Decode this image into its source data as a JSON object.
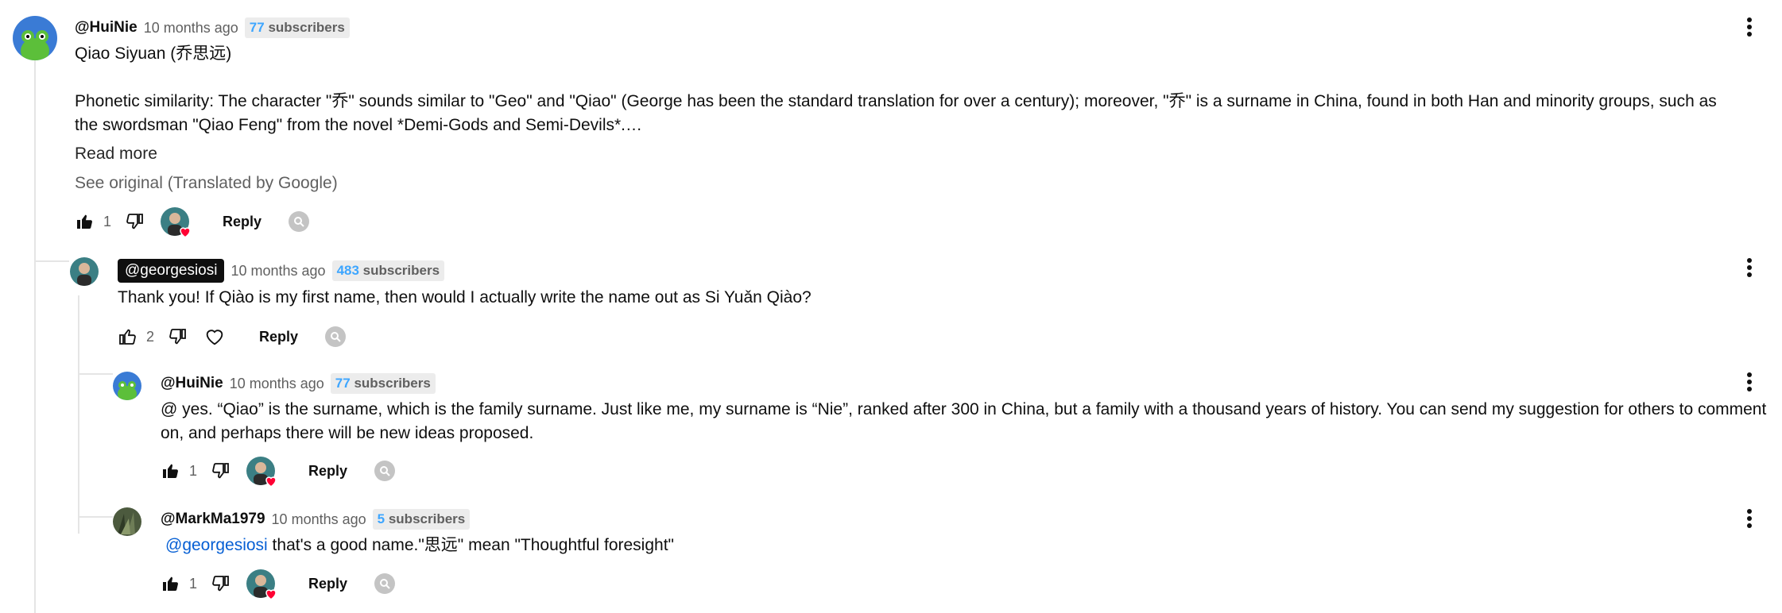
{
  "comment": {
    "handle": "@HuiNie",
    "time": "10 months ago",
    "subs_num": "77",
    "subs_label": "subscribers",
    "title_line": "Qiao Siyuan (乔思远)",
    "body": "Phonetic similarity: The character \"乔\" sounds similar to \"Geo\" and \"Qiao\" (George has been the standard translation for over a century); moreover, \"乔\" is a surname in China, found in both Han and minority groups, such as the swordsman \"Qiao Feng\" from the novel *Demi-Gods and Semi-Devils*.…",
    "read_more": "Read more",
    "see_original": "See original (Translated by Google)",
    "likes": "1",
    "reply_label": "Reply"
  },
  "replies": [
    {
      "handle": "@georgesiosi",
      "time": "10 months ago",
      "subs_num": "483",
      "subs_label": "subscribers",
      "body": "Thank you! If Qiào is my first name, then would I actually write the name out as Si Yuǎn Qiào?",
      "likes": "2",
      "reply_label": "Reply"
    },
    {
      "handle": "@HuiNie",
      "time": "10 months ago",
      "subs_num": "77",
      "subs_label": "subscribers",
      "body": "@ yes. “Qiao” is the surname, which is the family surname. Just like me, my surname is “Nie”, ranked after 300 in China, but a family with a thousand years of history. You can send my suggestion for others to comment on, and perhaps there will be new ideas proposed.",
      "likes": "1",
      "reply_label": "Reply"
    },
    {
      "handle": "@MarkMa1979",
      "time": "10 months ago",
      "subs_num": "5",
      "subs_label": "subscribers",
      "mention": "@georgesiosi",
      "body": " that's a good name.\"思远\" mean \"Thoughtful foresight\"",
      "likes": "1",
      "reply_label": "Reply"
    }
  ],
  "colors": {
    "accent_link": "#065fd4",
    "subs_number": "#3ea6ff",
    "heart": "#ff0033",
    "owner_badge": "#0f0f0f"
  },
  "icons": [
    "thumbs-up-icon",
    "thumbs-down-icon",
    "heart-icon",
    "more-vert-icon",
    "avatar-frog",
    "avatar-george",
    "avatar-plant"
  ]
}
